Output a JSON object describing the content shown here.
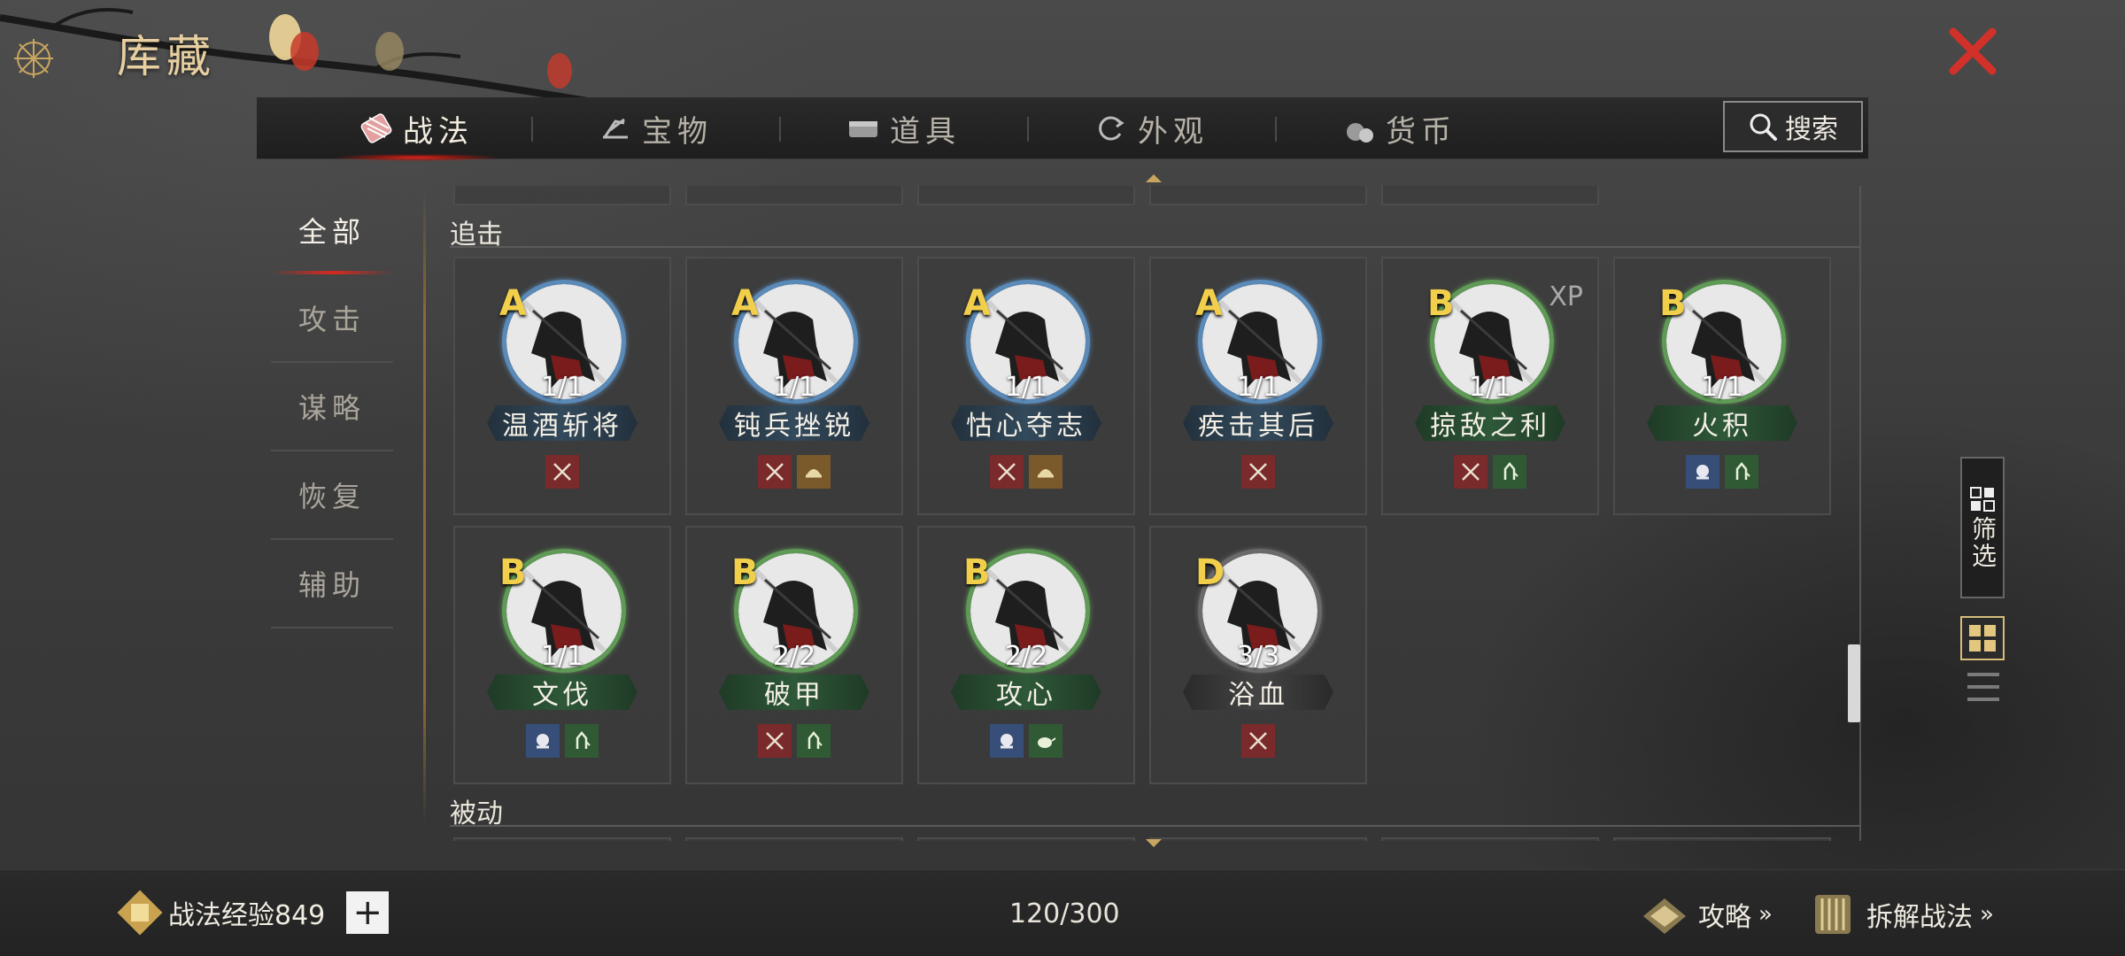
{
  "header": {
    "title": "库藏"
  },
  "tabs": [
    {
      "label": "战法",
      "icon": "scroll-bundle-icon",
      "active": true
    },
    {
      "label": "宝物",
      "icon": "treasure-cart-icon",
      "active": false
    },
    {
      "label": "道具",
      "icon": "chest-icon",
      "active": false
    },
    {
      "label": "外观",
      "icon": "swirl-icon",
      "active": false
    },
    {
      "label": "货币",
      "icon": "money-bag-icon",
      "active": false
    }
  ],
  "search": {
    "label": "搜索"
  },
  "categories": [
    {
      "label": "全部",
      "active": true
    },
    {
      "label": "攻击",
      "active": false
    },
    {
      "label": "谋略",
      "active": false
    },
    {
      "label": "恢复",
      "active": false
    },
    {
      "label": "辅助",
      "active": false
    }
  ],
  "sections": {
    "pursuit": "追击",
    "passive": "被动"
  },
  "cards": [
    {
      "grade": "A",
      "count": "1/1",
      "name": "温酒斩将",
      "ring": "blue",
      "tags": [
        "red-crossed-swords-icon"
      ]
    },
    {
      "grade": "A",
      "count": "1/1",
      "name": "钝兵挫锐",
      "ring": "blue",
      "tags": [
        "red-crossed-swords-icon",
        "brown-helmet-icon"
      ]
    },
    {
      "grade": "A",
      "count": "1/1",
      "name": "怙心夺志",
      "ring": "blue",
      "tags": [
        "red-crossed-swords-icon",
        "brown-helmet-icon"
      ]
    },
    {
      "grade": "A",
      "count": "1/1",
      "name": "疾击其后",
      "ring": "blue",
      "tags": [
        "red-crossed-swords-icon"
      ]
    },
    {
      "grade": "B",
      "count": "1/1",
      "name": "掠敌之利",
      "ring": "green",
      "xp": "XP",
      "tags": [
        "red-crossed-swords-icon",
        "green-heal-icon"
      ]
    },
    {
      "grade": "B",
      "count": "1/1",
      "name": "火积",
      "ring": "green",
      "tags": [
        "blue-strategy-icon",
        "green-heal-icon"
      ]
    },
    {
      "grade": "B",
      "count": "1/1",
      "name": "文伐",
      "ring": "green",
      "tags": [
        "blue-strategy-icon",
        "green-heal-icon"
      ]
    },
    {
      "grade": "B",
      "count": "2/2",
      "name": "破甲",
      "ring": "green",
      "tags": [
        "red-crossed-swords-icon",
        "green-heal-icon"
      ]
    },
    {
      "grade": "B",
      "count": "2/2",
      "name": "攻心",
      "ring": "green",
      "tags": [
        "blue-strategy-icon",
        "green-teapot-icon"
      ]
    },
    {
      "grade": "D",
      "count": "3/3",
      "name": "浴血",
      "ring": "gray",
      "tags": [
        "red-crossed-swords-icon"
      ]
    }
  ],
  "filter": {
    "label": "筛选"
  },
  "footer": {
    "exp_label": "战法经验849",
    "plus": "+",
    "capacity": "120/300",
    "guide_label": "攻略",
    "dismantle_label": "拆解战法",
    "chevron": "»"
  },
  "colors": {
    "grade": "#f2cf4b",
    "ring_blue": "#5a8ab8",
    "ring_green": "#5f9a56",
    "ring_gray": "#6a6a6a",
    "accent_red": "#d6291f",
    "title_gold": "#e8cfa0"
  }
}
